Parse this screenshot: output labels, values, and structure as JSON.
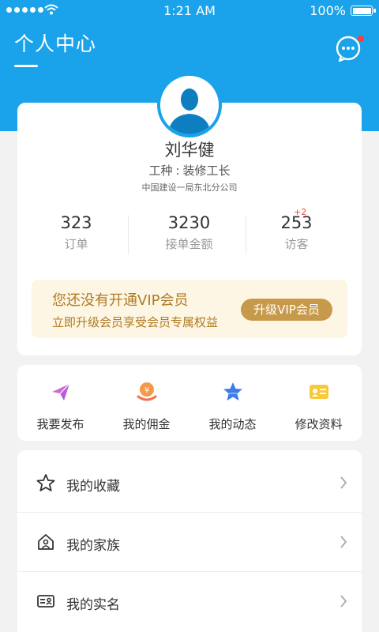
{
  "status_bar": {
    "time": "1:21 AM",
    "battery": "100%"
  },
  "header": {
    "title": "个人中心"
  },
  "profile": {
    "name": "刘华健",
    "job_label": "工种",
    "job_sep": ":",
    "job_value": "装修工长",
    "company": "中国建设一局东北分公司"
  },
  "stats": [
    {
      "value": "323",
      "label": "订单"
    },
    {
      "value": "3230",
      "label": "接单金额"
    },
    {
      "value": "253",
      "label": "访客"
    }
  ],
  "visitor_badge": "+2",
  "vip": {
    "title": "您还没有开通VIP会员",
    "subtitle": "立即升级会员享受会员专属权益",
    "button": "升级VIP会员"
  },
  "actions": [
    {
      "label": "我要发布",
      "icon": "paper-plane-icon"
    },
    {
      "label": "我的佣金",
      "icon": "yen-coin-icon"
    },
    {
      "label": "我的动态",
      "icon": "star-icon"
    },
    {
      "label": "修改资料",
      "icon": "id-card-icon"
    }
  ],
  "menu": [
    {
      "label": "我的收藏",
      "icon": "star-outline-icon"
    },
    {
      "label": "我的家族",
      "icon": "family-house-icon"
    },
    {
      "label": "我的实名",
      "icon": "id-card-outline-icon"
    }
  ],
  "colors": {
    "primary": "#1aa3ea",
    "vip_gold": "#c79a4b",
    "vip_bg": "#fdf6e4"
  }
}
